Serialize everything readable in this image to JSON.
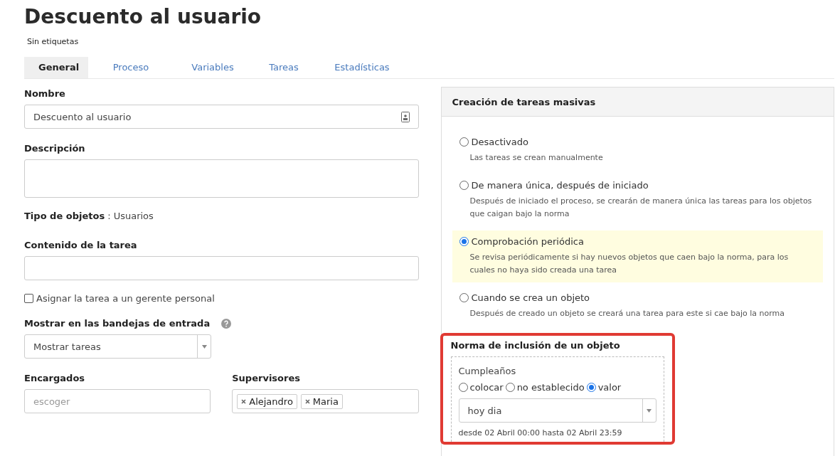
{
  "title": "Descuento al usuario",
  "tags_note": "Sin etiquetas",
  "tabs": [
    {
      "label": "General",
      "selected": true
    },
    {
      "label": "Proceso",
      "selected": false
    },
    {
      "label": "Variables",
      "selected": false
    },
    {
      "label": "Tareas",
      "selected": false
    },
    {
      "label": "Estadísticas",
      "selected": false
    }
  ],
  "form": {
    "name_label": "Nombre",
    "name_value": "Descuento al usuario",
    "description_label": "Descripción",
    "object_type_label": "Tipo de objetos",
    "object_type_value": ": Usuarios",
    "content_label": "Contenido de la tarea",
    "assign_checkbox": {
      "label": "Asignar la tarea a un gerente personal",
      "checked": false
    },
    "inbox_label": "Mostrar en las bandejas de entrada",
    "inbox_value": "Mostrar tareas",
    "assignees_label": "Encargados",
    "assignees_placeholder": "escoger",
    "supervisors_label": "Supervisores",
    "supervisors": [
      "Alejandro",
      "Maria"
    ]
  },
  "mass_tasks": {
    "title": "Creación de tareas masivas",
    "options": [
      {
        "label": "Desactivado",
        "hint": "Las tareas se crean manualmente",
        "selected": false
      },
      {
        "label": "De manera única, después de iniciado",
        "hint": "Después de iniciado el proceso, se crearán de manera única las tareas para los objetos que caigan bajo la norma",
        "selected": false
      },
      {
        "label": "Comprobación periódica",
        "hint": "Se revisa periódicamente si hay nuevos objetos que caen bajo la norma, para los cuales no haya sido creada una tarea",
        "selected": true
      },
      {
        "label": "Cuando se crea un objeto",
        "hint": "Después de creado un objeto se creará una tarea para este si cae bajo la norma",
        "selected": false
      }
    ],
    "rule": {
      "title": "Norma de inclusión de un objeto",
      "field": "Cumpleaños",
      "modes": [
        {
          "label": "colocar",
          "selected": false
        },
        {
          "label": "no establecido",
          "selected": false
        },
        {
          "label": "valor",
          "selected": true
        }
      ],
      "value": "hoy dia",
      "range": "desde 02 Abril 00:00 hasta 02 Abril 23:59"
    }
  }
}
